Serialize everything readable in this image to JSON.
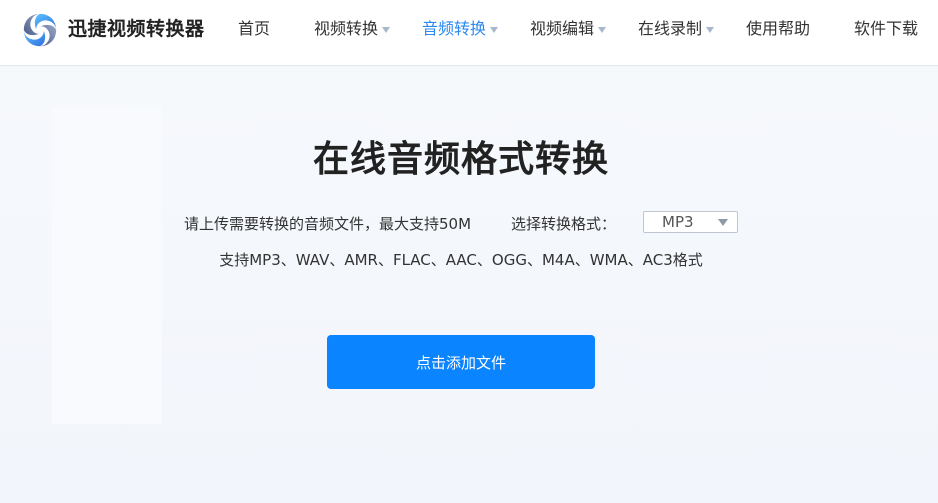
{
  "header": {
    "brand": "迅捷视频转换器",
    "nav": [
      {
        "label": "首页",
        "has_dropdown": false,
        "active": false
      },
      {
        "label": "视频转换",
        "has_dropdown": true,
        "active": false
      },
      {
        "label": "音频转换",
        "has_dropdown": true,
        "active": true
      },
      {
        "label": "视频编辑",
        "has_dropdown": true,
        "active": false
      },
      {
        "label": "在线录制",
        "has_dropdown": true,
        "active": false
      },
      {
        "label": "使用帮助",
        "has_dropdown": false,
        "active": false
      },
      {
        "label": "软件下载",
        "has_dropdown": false,
        "active": false
      }
    ]
  },
  "main": {
    "title": "在线音频格式转换",
    "description": "请上传需要转换的音频文件，最大支持50M",
    "format_label": "选择转换格式：",
    "format_selected": "MP3",
    "supported_formats": "支持MP3、WAV、AMR、FLAC、AAC、OGG、M4A、WMA、AC3格式",
    "upload_button": "点击添加文件"
  },
  "colors": {
    "accent": "#2b88f0",
    "button": "#0a84ff",
    "background": "#f3f6fb"
  },
  "icons": {
    "logo": "swirl-logo-icon",
    "dropdown": "caret-down-icon"
  }
}
